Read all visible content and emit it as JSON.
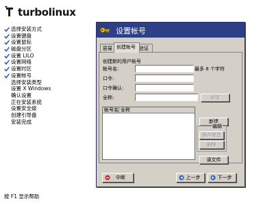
{
  "brand": {
    "name": "turbolinux"
  },
  "installer_steps": [
    {
      "label": "选择安装方式",
      "done": true
    },
    {
      "label": "设置键盘",
      "done": true
    },
    {
      "label": "设置鼠标",
      "done": true
    },
    {
      "label": "磁盘分区",
      "done": true
    },
    {
      "label": "设置 LILO",
      "done": true
    },
    {
      "label": "设置网络",
      "done": true
    },
    {
      "label": "设置时区",
      "done": true
    },
    {
      "label": "设置帐号",
      "done": true
    },
    {
      "label": "选择安装类型",
      "done": false
    },
    {
      "label": "设置 X Windows",
      "done": false
    },
    {
      "label": "确认设置",
      "done": false
    },
    {
      "label": "正在安装系统",
      "done": false
    },
    {
      "label": "设置安全级",
      "done": false
    },
    {
      "label": "创建引导盘",
      "done": false
    },
    {
      "label": "安装完成",
      "done": false
    }
  ],
  "help_text": "按 F1 显示帮助",
  "dialog": {
    "title": "设置帐号",
    "tabs": [
      "容易",
      "创建帐号",
      "验证"
    ],
    "active_tab": "创建帐号",
    "section_label": "创建新的用户帐号",
    "fields": {
      "account_label": "帐号名:",
      "account_value": "",
      "account_hint": "最多 8 个字符",
      "password_label": "口令:",
      "password_value": "",
      "confirm_label": "口令确认:",
      "confirm_value": "",
      "fullname_label": "全称:",
      "fullname_value": ""
    },
    "add_button": "添加",
    "list_columns": [
      "帐号名",
      "全称"
    ],
    "new_button": "新建",
    "edit_group_label": "编辑",
    "save_button": "保存修改",
    "delete_button": "删除",
    "read_file_button": "读文件",
    "cancel_button": "中断",
    "prev_button": "上一步",
    "next_button": "下一步"
  },
  "colors": {
    "titlebar": "#2d3f86",
    "dialog_face": "#d4d0c8",
    "check_blue": "#2e5fb8",
    "cancel_red": "#c8202a"
  }
}
